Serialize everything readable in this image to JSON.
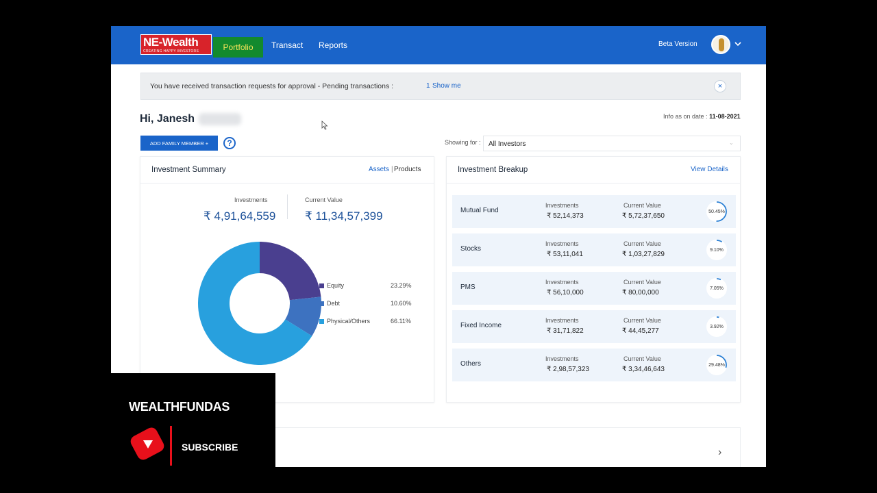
{
  "header": {
    "logo_text": "E-Wealth",
    "logo_prefix": "N",
    "logo_tagline": "CREATING HAPPY INVESTORS",
    "nav": {
      "portfolio": "Portfolio",
      "transact": "Transact",
      "reports": "Reports"
    },
    "beta_label": "Beta Version"
  },
  "notice": {
    "text": "You have received transaction requests for approval - Pending transactions :",
    "count": "1",
    "link": "Show me",
    "close": "×"
  },
  "greeting": "Hi, Janesh",
  "info_date": {
    "label": "Info as on date :",
    "value": "11-08-2021"
  },
  "add_member_label": "ADD FAMILY MEMBER +",
  "help": "?",
  "showing_for": {
    "label": "Showing for :",
    "value": "All Investors"
  },
  "summary": {
    "title": "Investment Summary",
    "assets_link": "Assets",
    "separator": "|",
    "products_link": "Products",
    "investments_label": "Investments",
    "investments_value": "₹ 4,91,64,559",
    "current_label": "Current Value",
    "current_value": "₹ 11,34,57,399",
    "chart_data": {
      "type": "pie",
      "categories": [
        "Equity",
        "Debt",
        "Physical/Others"
      ],
      "values": [
        23.29,
        10.6,
        66.11
      ],
      "labels": [
        "23.29%",
        "10.60%",
        "66.11%"
      ],
      "colors": [
        "#4a3f8f",
        "#3d72c0",
        "#28a0de"
      ]
    }
  },
  "breakup": {
    "title": "Investment Breakup",
    "view_details": "View Details",
    "rows": [
      {
        "name": "Mutual Fund",
        "inv_label": "Investments",
        "inv": "₹ 52,14,373",
        "cur_label": "Current Value",
        "cur": "₹ 5,72,37,650",
        "pct": "50.45%",
        "pct_num": 50.45
      },
      {
        "name": "Stocks",
        "inv_label": "Investments",
        "inv": "₹ 53,11,041",
        "cur_label": "Current Value",
        "cur": "₹ 1,03,27,829",
        "pct": "9.10%",
        "pct_num": 9.1
      },
      {
        "name": "PMS",
        "inv_label": "Investments",
        "inv": "₹ 56,10,000",
        "cur_label": "Current Value",
        "cur": "₹ 80,00,000",
        "pct": "7.05%",
        "pct_num": 7.05
      },
      {
        "name": "Fixed Income",
        "inv_label": "Investments",
        "inv": "₹ 31,71,822",
        "cur_label": "Current Value",
        "cur": "₹ 44,45,277",
        "pct": "3.92%",
        "pct_num": 3.92
      },
      {
        "name": "Others",
        "inv_label": "Investments",
        "inv": "₹ 2,98,57,323",
        "cur_label": "Current Value",
        "cur": "₹ 3,34,46,643",
        "pct": "29.48%",
        "pct_num": 29.48
      }
    ]
  },
  "overlay": {
    "channel": "WEALTHFUNDAS",
    "subscribe": "SUBSCRIBE"
  }
}
